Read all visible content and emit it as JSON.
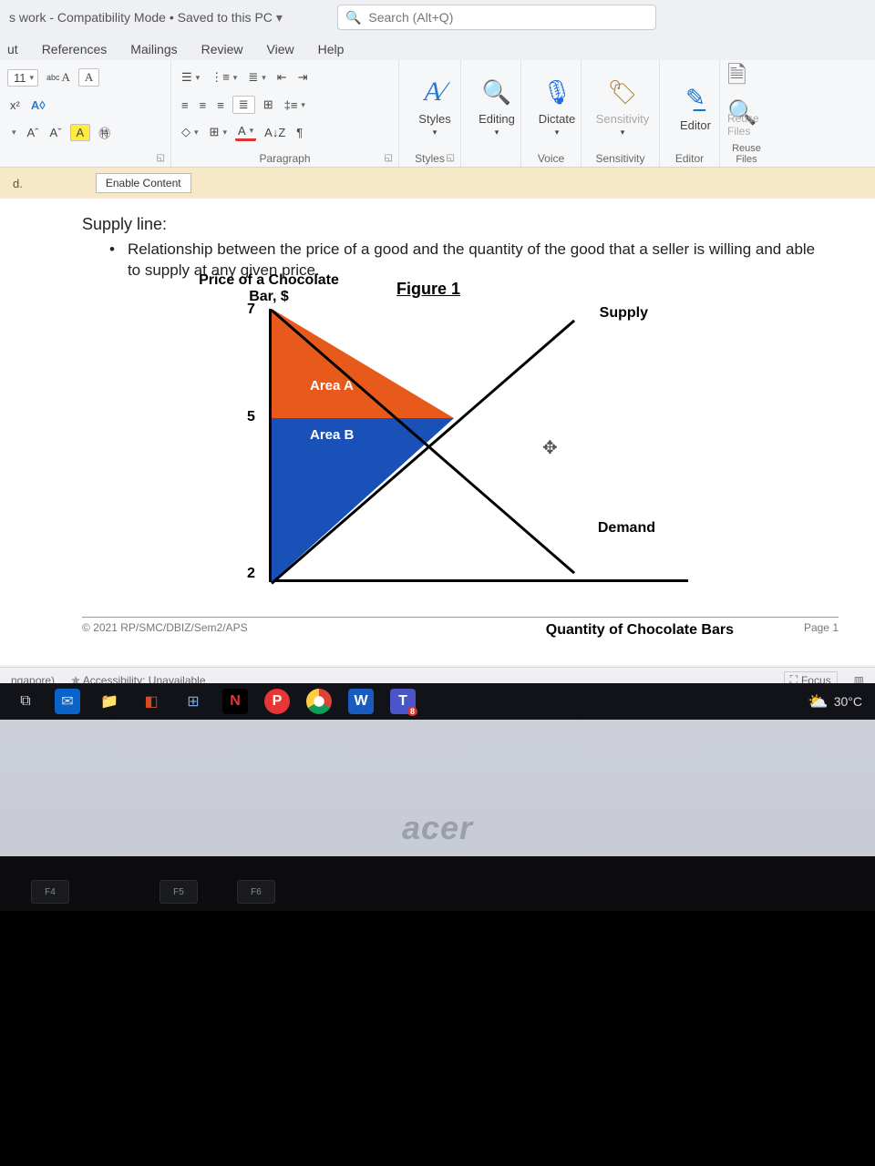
{
  "titlebar": {
    "text": "s work - Compatibility Mode • Saved to this PC",
    "search_placeholder": "Search (Alt+Q)"
  },
  "tabs": {
    "t0": "ut",
    "t1": "References",
    "t2": "Mailings",
    "t3": "Review",
    "t4": "View",
    "t5": "Help"
  },
  "ribbon": {
    "font_size": "11",
    "paragraph_label": "Paragraph",
    "styles_label": "Styles",
    "styles_group": "Styles",
    "editing": "Editing",
    "dictate": "Dictate",
    "voice": "Voice",
    "sensitivity": "Sensitivity",
    "sensitivity_group": "Sensitivity",
    "editor": "Editor",
    "editor_group": "Editor",
    "reuse": "Reuse Files",
    "reuse_btn": "Reuse Files"
  },
  "security": {
    "d_label": "d.",
    "enable": "Enable Content"
  },
  "document": {
    "heading": "Supply line:",
    "bullet": "Relationship between the price of a good and the quantity of the good that a seller is willing and able to supply at any given price.",
    "footer_left": "© 2021 RP/SMC/DBIZ/Sem2/APS",
    "footer_right": "Page 1"
  },
  "chart_data": {
    "type": "line",
    "title": "Figure 1",
    "ylabel": "Price of a Chocolate Bar, $",
    "xlabel": "Quantity of Chocolate Bars",
    "ylim": [
      2,
      7
    ],
    "y_ticks": [
      7,
      5,
      2
    ],
    "series": [
      {
        "name": "Supply",
        "values": "upward-sloping"
      },
      {
        "name": "Demand",
        "values": "downward-sloping"
      }
    ],
    "regions": [
      {
        "name": "Area A",
        "fill": "#e85a1c",
        "desc": "triangle between p=5 and p=7 on demand curve"
      },
      {
        "name": "Area B",
        "fill": "#1951b8",
        "desc": "triangle between p=2 and p=5 on demand curve"
      }
    ],
    "labels": {
      "supply": "Supply",
      "demand": "Demand",
      "areaA": "Area A",
      "areaB": "Area B",
      "t7": "7",
      "t5": "5",
      "t2": "2"
    }
  },
  "statusbar": {
    "lang": "ngapore)",
    "accessibility": "Accessibility: Unavailable",
    "focus": "Focus"
  },
  "taskbar": {
    "temp": "30°C",
    "t_badge": "8"
  },
  "laptop": {
    "brand": "acer",
    "k_f4": "F4",
    "k_f5": "F5",
    "k_f6": "F6"
  }
}
